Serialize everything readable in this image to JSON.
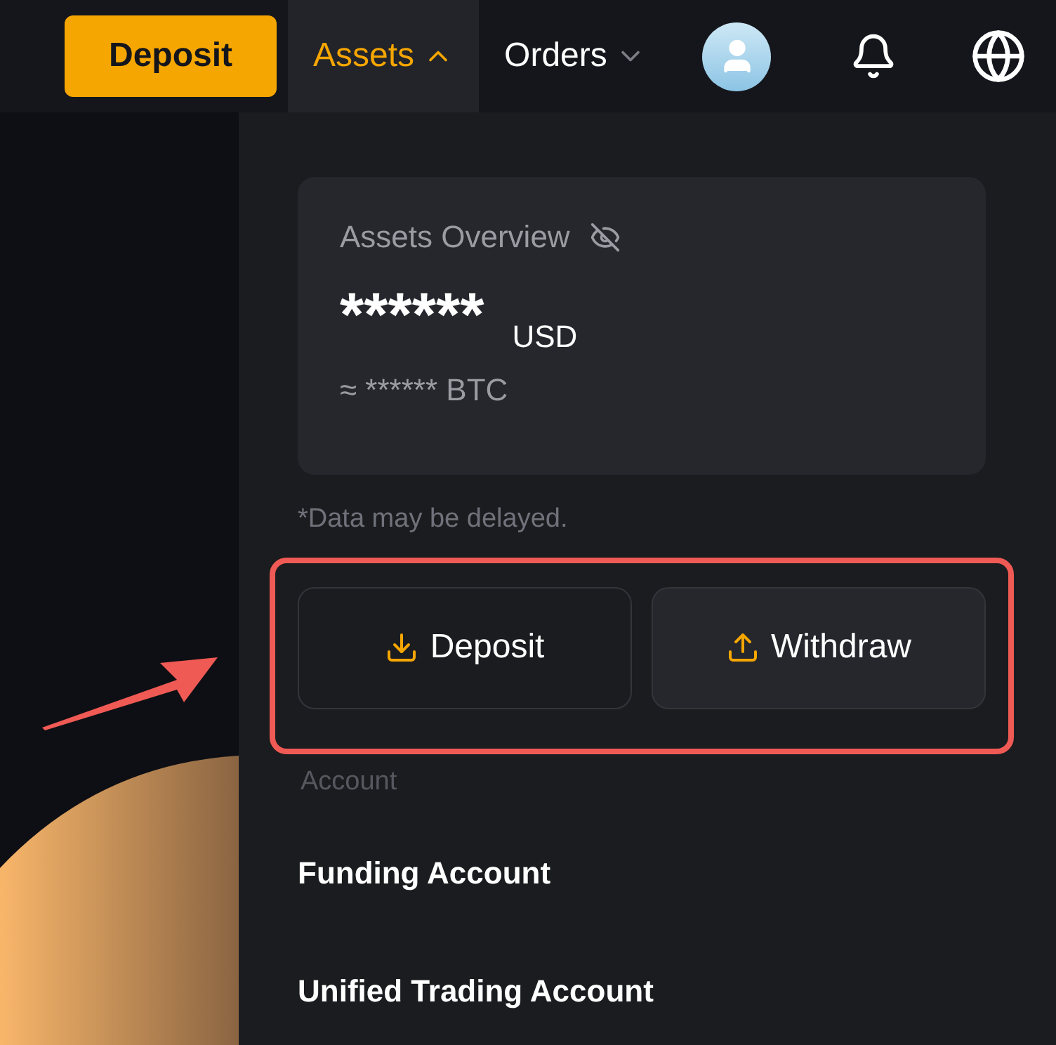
{
  "header": {
    "deposit_button": "Deposit",
    "menus": [
      {
        "label": "Assets",
        "selected": true,
        "expanded": true
      },
      {
        "label": "Orders",
        "selected": false,
        "expanded": false
      }
    ]
  },
  "assets_dropdown": {
    "overview": {
      "title": "Assets Overview",
      "balance": "******",
      "currency": "USD",
      "btc_equivalent": "≈ ****** BTC"
    },
    "note": "*Data may be delayed.",
    "actions": [
      {
        "label": "Deposit",
        "kind": "deposit"
      },
      {
        "label": "Withdraw",
        "kind": "withdraw"
      }
    ],
    "section_label": "Account",
    "accounts": [
      "Funding Account",
      "Unified Trading Account"
    ]
  }
}
